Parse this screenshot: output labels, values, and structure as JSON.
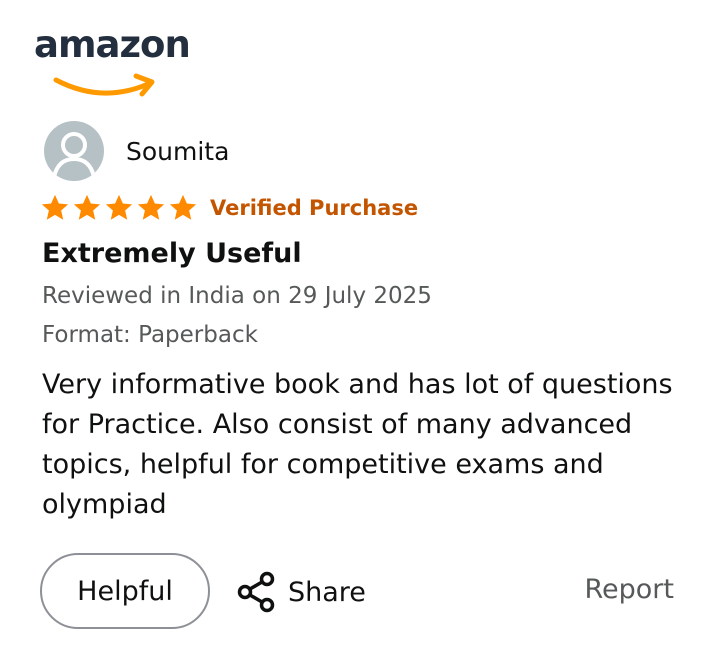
{
  "brand": {
    "logo_text": "amazon",
    "smile_color": "#ff9900"
  },
  "review": {
    "reviewer_name": "Soumita",
    "rating": 5,
    "rating_max": 5,
    "verified_label": "Verified Purchase",
    "title": "Extremely Useful",
    "date_line": "Reviewed in India on 29 July 2025",
    "format_line": "Format: Paperback",
    "body": "Very informative book and has lot of questions for Practice. Also consist of many advanced topics, helpful for competitive exams and olympiad"
  },
  "actions": {
    "helpful_label": "Helpful",
    "share_label": "Share",
    "report_label": "Report"
  },
  "colors": {
    "star": "#ff8a00",
    "verified": "#c45500",
    "avatar_bg": "#b6c1c6"
  },
  "icons": {
    "avatar": "person-icon",
    "share": "share-icon",
    "star": "star-icon"
  }
}
